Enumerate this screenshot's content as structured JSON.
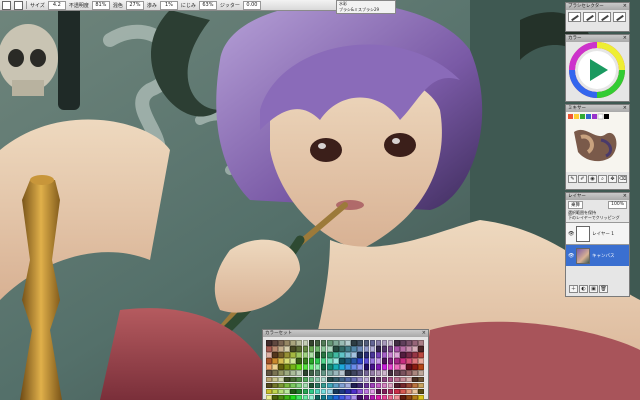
{
  "app": {
    "toolbar": {
      "size_label": "サイズ",
      "size_value": "4.2",
      "density_label": "不透明度",
      "density_value": "81%",
      "mix_label": "混色",
      "mix_value": "27%",
      "flow_label": "渗み",
      "flow_value": "1%",
      "blend_label": "にじみ",
      "blend_value": "63%",
      "jitter_label": "ジッター",
      "jitter_value": "0.00"
    },
    "brush": {
      "category": "水彩",
      "name": "ブラシ&水彩ペン",
      "variant": "ブラシ&ミスブラシ29"
    },
    "palettes": {
      "brush_palette_title": "ブラシセレクター",
      "color_palette_title": "カラー",
      "mixer_title": "ミキサー",
      "layers_title": "レイヤー",
      "layers_blend": "乗算",
      "layers_opacity": "100%",
      "layers_options": "選択範囲を保持\n下のレイヤーでクリッピング",
      "layers": [
        {
          "name": "レイヤー 1",
          "selected": false
        },
        {
          "name": "キャンバス",
          "selected": true
        }
      ],
      "colorset_title": "カラーセット"
    },
    "colors": {
      "panel_bg": "#e6e6e6",
      "titlebar": "#b5b5b5",
      "selection": "#3a6fd0"
    }
  }
}
